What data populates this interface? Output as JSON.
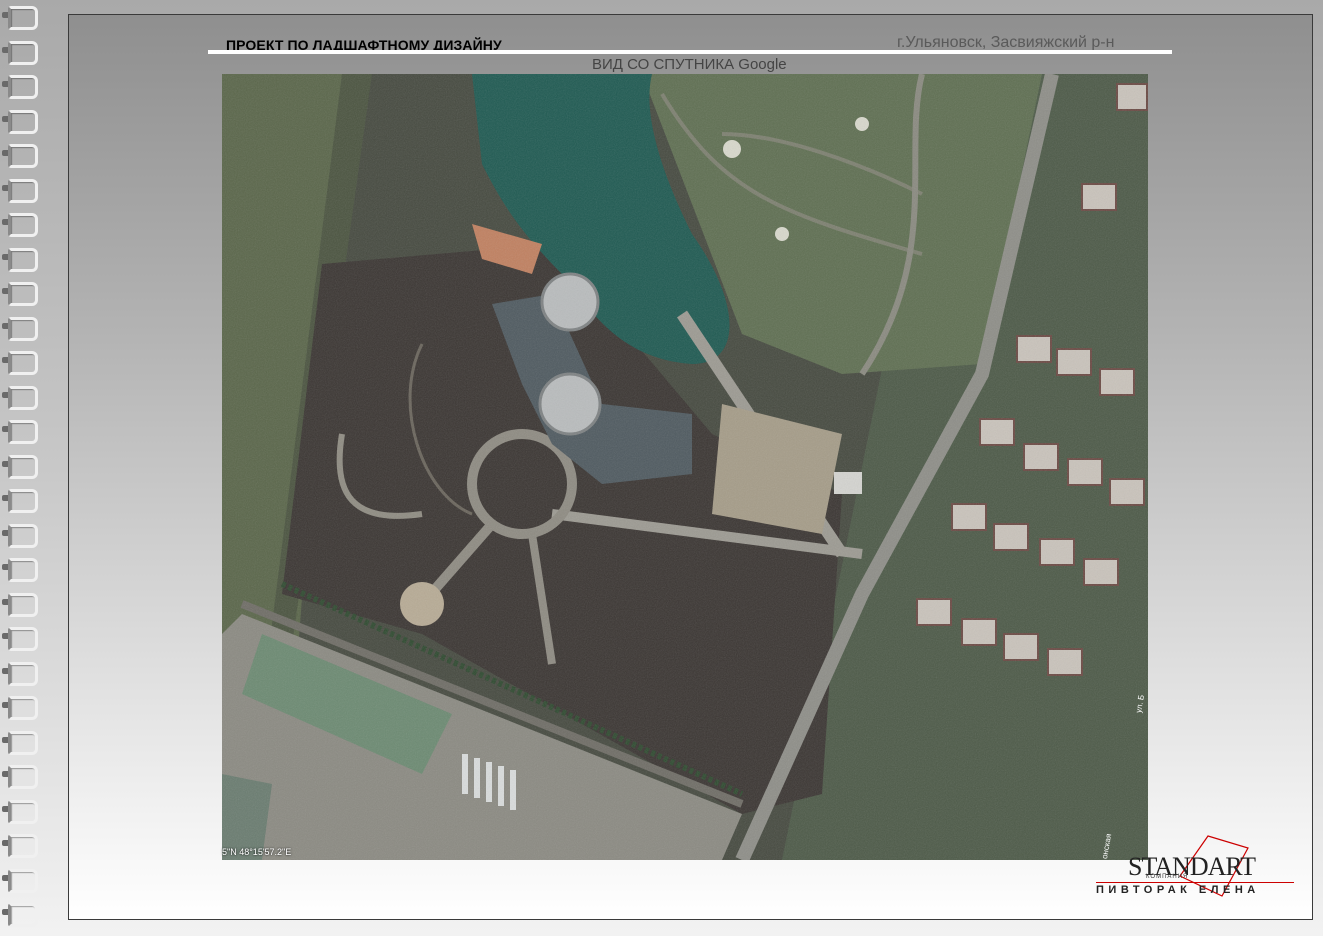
{
  "header": {
    "project_title": "ПРОЕКТ ПО ЛАДШАФТНОМУ ДИЗАЙНУ",
    "location": "г.Ульяновск, Засвияжский р-н",
    "view_caption": "ВИД СО СПУТНИКА Google"
  },
  "map": {
    "coordinates": "5\"N 48°15'57.2\"E",
    "street_label_1": "ул. Б",
    "street_label_2": "онская"
  },
  "logo": {
    "brand": "STANDART",
    "company": "КОМПАНИЯ",
    "author": "ПИВТОРАК ЕЛЕНА"
  },
  "colors": {
    "accent": "#cc0000",
    "water": "#1f5a52",
    "roof": "#4f5a60",
    "soil": "#3a3734",
    "grass": "#5d6b4e"
  }
}
